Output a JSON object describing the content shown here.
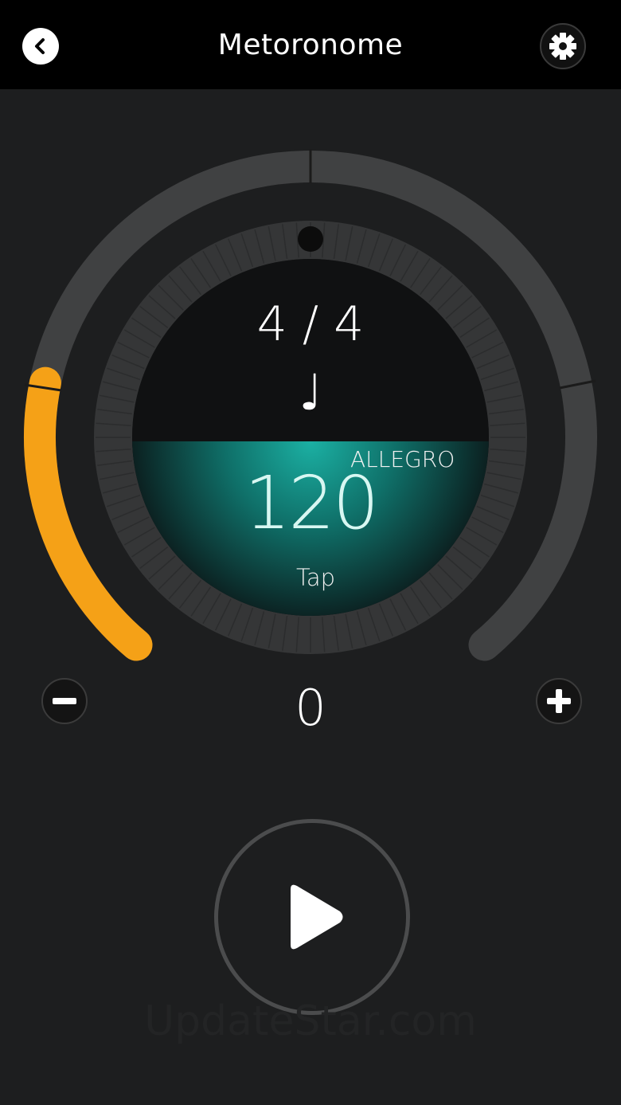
{
  "header": {
    "title": "Metoronome",
    "back_icon": "chevron-left-icon",
    "settings_icon": "gear-icon"
  },
  "metronome": {
    "time_signature": "4 / 4",
    "note_value": "♩",
    "tempo_name": "ALLEGRO",
    "bpm": "120",
    "tap_label": "Tap",
    "beat_counter": "0",
    "dial_fill_fraction": 0.22
  },
  "controls": {
    "minus_icon": "minus-icon",
    "plus_icon": "plus-icon",
    "play_icon": "play-icon"
  },
  "watermark": "UpdateStar.com",
  "colors": {
    "accent": "#f5a117",
    "teal": "#1aa79a",
    "track": "#404142",
    "background": "#1d1e1f"
  }
}
